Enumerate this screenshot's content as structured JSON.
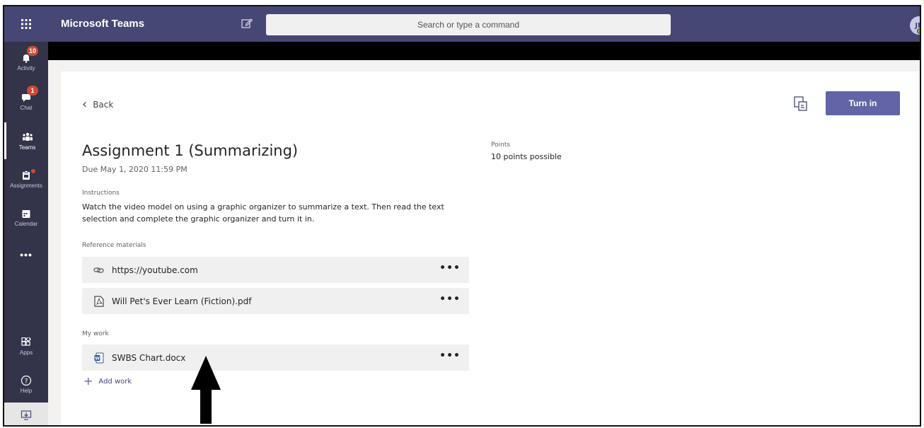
{
  "app": {
    "title": "Microsoft Teams",
    "search_placeholder": "Search or type a command",
    "avatar_initials": "JB"
  },
  "rail": [
    {
      "label": "Activity",
      "badge": "10",
      "icon": "bell-icon"
    },
    {
      "label": "Chat",
      "badge": "1",
      "icon": "chat-icon"
    },
    {
      "label": "Teams",
      "icon": "teams-icon"
    },
    {
      "label": "Assignments",
      "icon": "assignments-icon"
    },
    {
      "label": "Calendar",
      "icon": "calendar-icon"
    },
    {
      "label": "Apps",
      "icon": "apps-icon"
    },
    {
      "label": "Help",
      "icon": "help-icon"
    }
  ],
  "assignment": {
    "back_label": "Back",
    "turn_in_label": "Turn in",
    "title": "Assignment 1 (Summarizing)",
    "due": "Due May 1, 2020 11:59 PM",
    "points_label": "Points",
    "points_value": "10 points possible",
    "instructions_label": "Instructions",
    "instructions_text": "Watch the video model on using a graphic organizer to summarize a text. Then read the text selection and complete the graphic organizer and turn it in.",
    "reference_label": "Reference materials",
    "references": [
      {
        "name": "https://youtube.com",
        "icon": "link-icon"
      },
      {
        "name": "Will Pet's Ever Learn (Fiction).pdf",
        "icon": "pdf-icon"
      }
    ],
    "my_work_label": "My work",
    "my_work": [
      {
        "name": "SWBS Chart.docx",
        "icon": "word-doc-icon"
      }
    ],
    "add_work_label": "Add work",
    "more_glyph": "•••"
  },
  "colors": {
    "header": "#464775",
    "rail": "#33344a",
    "accent": "#6264a7",
    "badge": "#cc4a31"
  }
}
